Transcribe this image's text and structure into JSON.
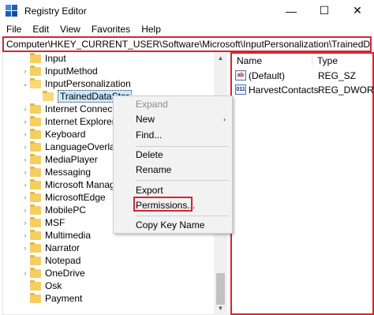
{
  "window": {
    "title": "Registry Editor",
    "controls": {
      "minimize": "—",
      "maximize": "☐",
      "close": "✕"
    }
  },
  "menubar": [
    "File",
    "Edit",
    "View",
    "Favorites",
    "Help"
  ],
  "address": "Computer\\HKEY_CURRENT_USER\\Software\\Microsoft\\InputPersonalization\\TrainedDataStore",
  "tree": [
    {
      "label": "Input",
      "chevron": ""
    },
    {
      "label": "InputMethod",
      "chevron": "›"
    },
    {
      "label": "InputPersonalization",
      "chevron": "⌄"
    },
    {
      "label": "TrainedDataStor",
      "chevron": "",
      "selected": true
    },
    {
      "label": "Internet Connection",
      "chevron": "›"
    },
    {
      "label": "Internet Explorer",
      "chevron": "›"
    },
    {
      "label": "Keyboard",
      "chevron": "›"
    },
    {
      "label": "LanguageOverlay",
      "chevron": "›"
    },
    {
      "label": "MediaPlayer",
      "chevron": "›"
    },
    {
      "label": "Messaging",
      "chevron": "›"
    },
    {
      "label": "Microsoft Manager",
      "chevron": "›"
    },
    {
      "label": "MicrosoftEdge",
      "chevron": "›"
    },
    {
      "label": "MobilePC",
      "chevron": "›"
    },
    {
      "label": "MSF",
      "chevron": "›"
    },
    {
      "label": "Multimedia",
      "chevron": "›"
    },
    {
      "label": "Narrator",
      "chevron": "›"
    },
    {
      "label": "Notepad",
      "chevron": ""
    },
    {
      "label": "OneDrive",
      "chevron": "›"
    },
    {
      "label": "Osk",
      "chevron": ""
    },
    {
      "label": "Payment",
      "chevron": ""
    }
  ],
  "list": {
    "headers": {
      "name": "Name",
      "type": "Type"
    },
    "rows": [
      {
        "icon": "ab",
        "name": "(Default)",
        "type": "REG_SZ"
      },
      {
        "icon": "011",
        "name": "HarvestContacts",
        "type": "REG_DWORD"
      }
    ]
  },
  "context_menu": {
    "expand": "Expand",
    "new": "New",
    "new_arrow": "›",
    "find": "Find...",
    "delete": "Delete",
    "rename": "Rename",
    "export": "Export",
    "permissions": "Permissions...",
    "copy_key_name": "Copy Key Name"
  },
  "colors": {
    "highlight": "#d9232d",
    "selection": "#cce8ff",
    "folder": "#f3cf62"
  }
}
